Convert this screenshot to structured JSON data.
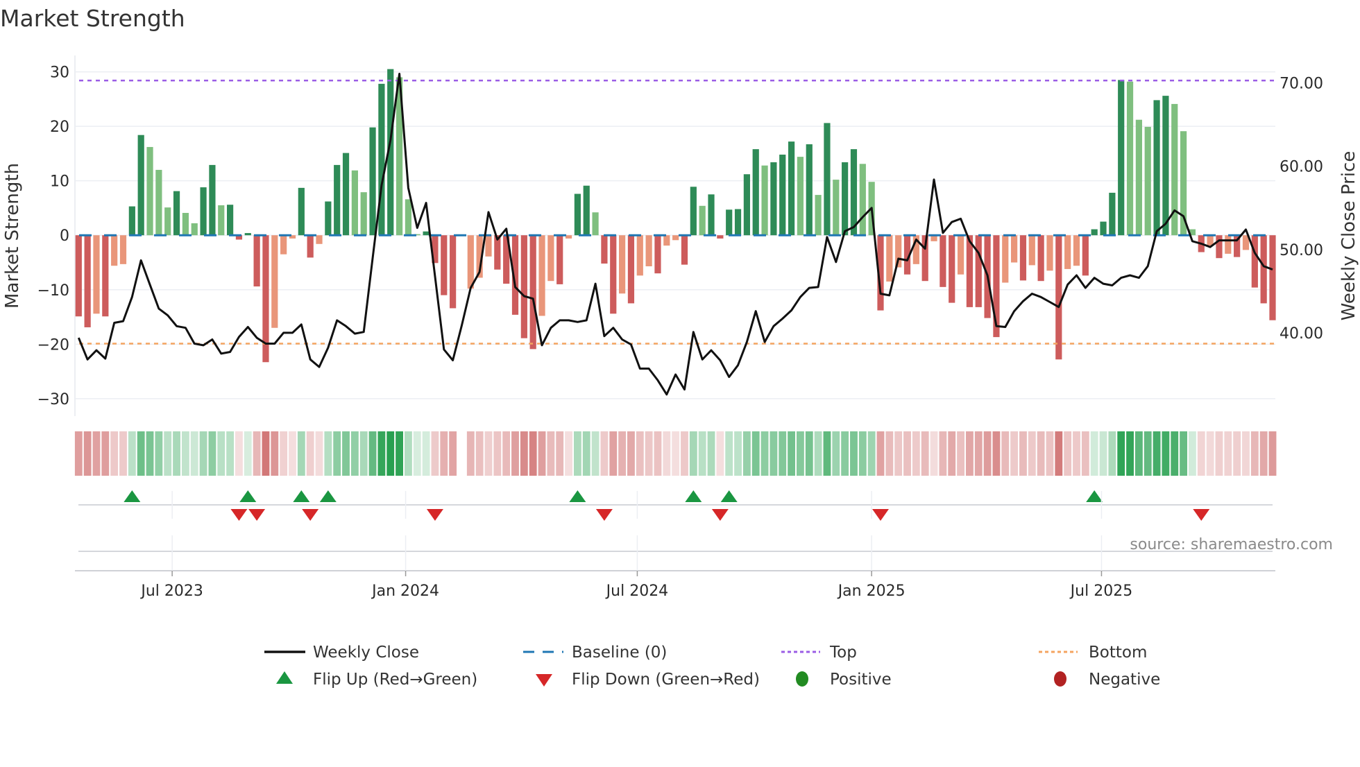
{
  "chart_data": {
    "type": "bar",
    "title": "Market Strength",
    "ylabel": "Market Strength",
    "y2label": "Weekly Close Price",
    "ylim": [
      -33.2,
      33
    ],
    "y2lim": [
      30,
      73.3
    ],
    "yticks": [
      30,
      20,
      10,
      0,
      -10,
      -20,
      -30
    ],
    "ytick_labels": [
      "30",
      "20",
      "10",
      "0",
      "−10",
      "−20",
      "−30"
    ],
    "y2ticks": [
      70,
      60,
      50,
      40
    ],
    "y2tick_labels": [
      "70.00",
      "60.00",
      "50.00",
      "40.00"
    ],
    "xtick_labels": [
      "Jul 2023",
      "Jan 2024",
      "Jul 2024",
      "Jan 2025",
      "Jul 2025"
    ],
    "xtick_week_index": [
      10.5,
      36.7,
      62.7,
      89,
      114.8
    ],
    "grid": true,
    "top_level": 28.4,
    "bottom_level": -19.9,
    "baseline": 0,
    "strength": [
      -14.9,
      -16.9,
      -14.4,
      -14.9,
      -5.6,
      -5.3,
      5.3,
      18.4,
      16.2,
      12.0,
      5.1,
      8.1,
      4.1,
      2.2,
      8.8,
      12.9,
      5.5,
      5.6,
      -0.8,
      0.4,
      -9.4,
      -23.3,
      -17.0,
      -3.5,
      -0.6,
      8.7,
      -4.1,
      -1.6,
      6.2,
      12.9,
      15.1,
      11.9,
      7.9,
      19.8,
      27.8,
      30.5,
      29.0,
      6.6,
      0.2,
      0.7,
      -5.1,
      -11.0,
      -13.4,
      0,
      -9.8,
      -7.8,
      -3.9,
      -6.3,
      -8.9,
      -14.6,
      -18.9,
      -20.9,
      -14.8,
      -8.4,
      -9.0,
      -0.6,
      7.6,
      9.1,
      4.2,
      -5.2,
      -14.4,
      -10.7,
      -12.5,
      -7.4,
      -5.7,
      -7.0,
      -1.9,
      -0.9,
      -5.4,
      8.9,
      5.4,
      7.5,
      -0.6,
      4.7,
      4.8,
      11.2,
      15.8,
      12.8,
      13.4,
      14.8,
      17.2,
      14.4,
      16.7,
      7.4,
      20.6,
      10.2,
      13.4,
      15.8,
      13.1,
      9.8,
      -13.8,
      -8.5,
      -5.9,
      -7.2,
      -5.3,
      -8.4,
      -1.1,
      -9.5,
      -12.4,
      -7.2,
      -13.2,
      -13.2,
      -15.2,
      -18.7,
      -8.7,
      -5.0,
      -8.3,
      -5.5,
      -8.4,
      -6.5,
      -22.8,
      -6.2,
      -5.6,
      -7.4,
      1.1,
      2.5,
      7.8,
      28.5,
      28.2,
      21.2,
      19.9,
      24.8,
      25.6,
      24.1,
      19.1,
      1.1,
      -3.1,
      -1.9,
      -4.2,
      -3.4,
      -4.0,
      -2.7,
      -9.6,
      -12.5,
      -15.6
    ],
    "shade": "DDLDLLDDLLLDLLDDLDDDDDLLLDDLDDDLLDDDLLLDDDDDLLLDDDDDLLDLDDLDDLDLLDLLDDLDDDDDDLDDDLDLDLDDLLDLLDLDLDDLDDDDLLDLDLDLLDDDDDLLLDDLLLDLDLDLDDD",
    "weekly_close": [
      39.4,
      36.8,
      37.9,
      36.9,
      41.2,
      41.4,
      44.3,
      48.7,
      45.8,
      42.9,
      42.1,
      40.8,
      40.6,
      38.7,
      38.5,
      39.2,
      37.5,
      37.7,
      39.5,
      40.7,
      39.4,
      38.7,
      38.7,
      40.0,
      40.0,
      41.0,
      36.8,
      35.9,
      38.2,
      41.5,
      40.8,
      39.9,
      40.1,
      49.0,
      57.7,
      63.1,
      71.1,
      57.4,
      52.6,
      55.6,
      46.8,
      38.0,
      36.7,
      40.9,
      45.4,
      47.3,
      54.5,
      51.2,
      52.5,
      45.5,
      44.4,
      44.1,
      38.5,
      40.6,
      41.5,
      41.5,
      41.3,
      41.5,
      45.9,
      39.6,
      40.6,
      39.2,
      38.6,
      35.7,
      35.7,
      34.3,
      32.6,
      35.0,
      33.2,
      40.1,
      36.8,
      37.9,
      36.7,
      34.7,
      36.1,
      38.9,
      42.6,
      38.9,
      40.8,
      41.7,
      42.7,
      44.3,
      45.4,
      45.5,
      51.5,
      48.5,
      52.2,
      52.7,
      53.9,
      55.0,
      44.7,
      44.5,
      48.9,
      48.7,
      51.2,
      50.1,
      58.4,
      52.0,
      53.3,
      53.7,
      51.0,
      49.6,
      46.9,
      40.8,
      40.7,
      42.6,
      43.8,
      44.7,
      44.3,
      43.7,
      43.1,
      45.8,
      46.9,
      45.4,
      46.6,
      45.9,
      45.7,
      46.6,
      46.9,
      46.6,
      48.0,
      52.2,
      53.1,
      54.7,
      54.0,
      51.0,
      50.7,
      50.3,
      51.1,
      51.1,
      51.1,
      52.4,
      49.6,
      48.0,
      47.6
    ],
    "legend": {
      "placement": "bottom",
      "items": [
        {
          "label": "Weekly Close"
        },
        {
          "label": "Baseline (0)"
        },
        {
          "label": "Top"
        },
        {
          "label": "Bottom"
        },
        {
          "label": "Flip Up (Red→Green)"
        },
        {
          "label": "Flip Down (Green→Red)"
        },
        {
          "label": "Positive"
        },
        {
          "label": "Negative"
        }
      ]
    },
    "source": "source: sharemaestro.com"
  },
  "colors": {
    "green_dark": "#2e8b57",
    "green_light": "#7fbf7f",
    "red_dark": "#cd5c5c",
    "red_light": "#e9967a",
    "line": "#111111",
    "baseline": "#1f77b4",
    "top": "#9b5de5",
    "bottom": "#f4a460",
    "flip_up": "#1a9641",
    "flip_down": "#d62728",
    "positive": "#228b22",
    "negative": "#b22222"
  }
}
